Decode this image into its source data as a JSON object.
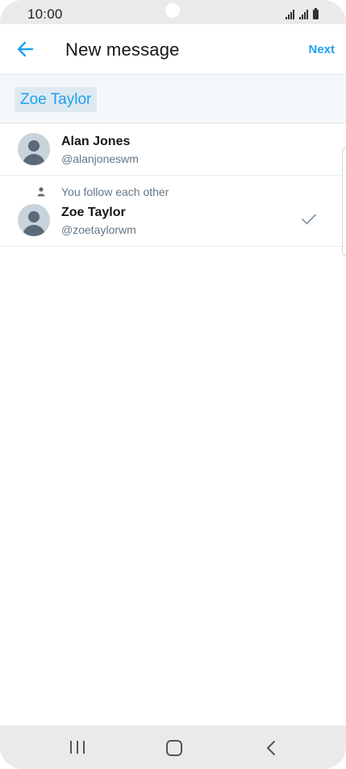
{
  "status_bar": {
    "time": "10:00"
  },
  "header": {
    "back_icon": "arrow-left-icon",
    "title": "New message",
    "next_label": "Next"
  },
  "recipients": {
    "selected": [
      "Zoe Taylor"
    ]
  },
  "users": [
    {
      "name": "Alan Jones",
      "handle": "@alanjoneswm",
      "selected": false
    },
    {
      "note": "You follow each other",
      "name": "Zoe Taylor",
      "handle": "@zoetaylorwm",
      "selected": true
    }
  ],
  "colors": {
    "accent": "#1da1f2",
    "chip_bg": "#dfe9f1",
    "muted_text": "#657786",
    "bar_bg": "#eaeaea"
  },
  "nav": {
    "icons": [
      "recent-apps-icon",
      "home-icon",
      "back-icon"
    ]
  }
}
